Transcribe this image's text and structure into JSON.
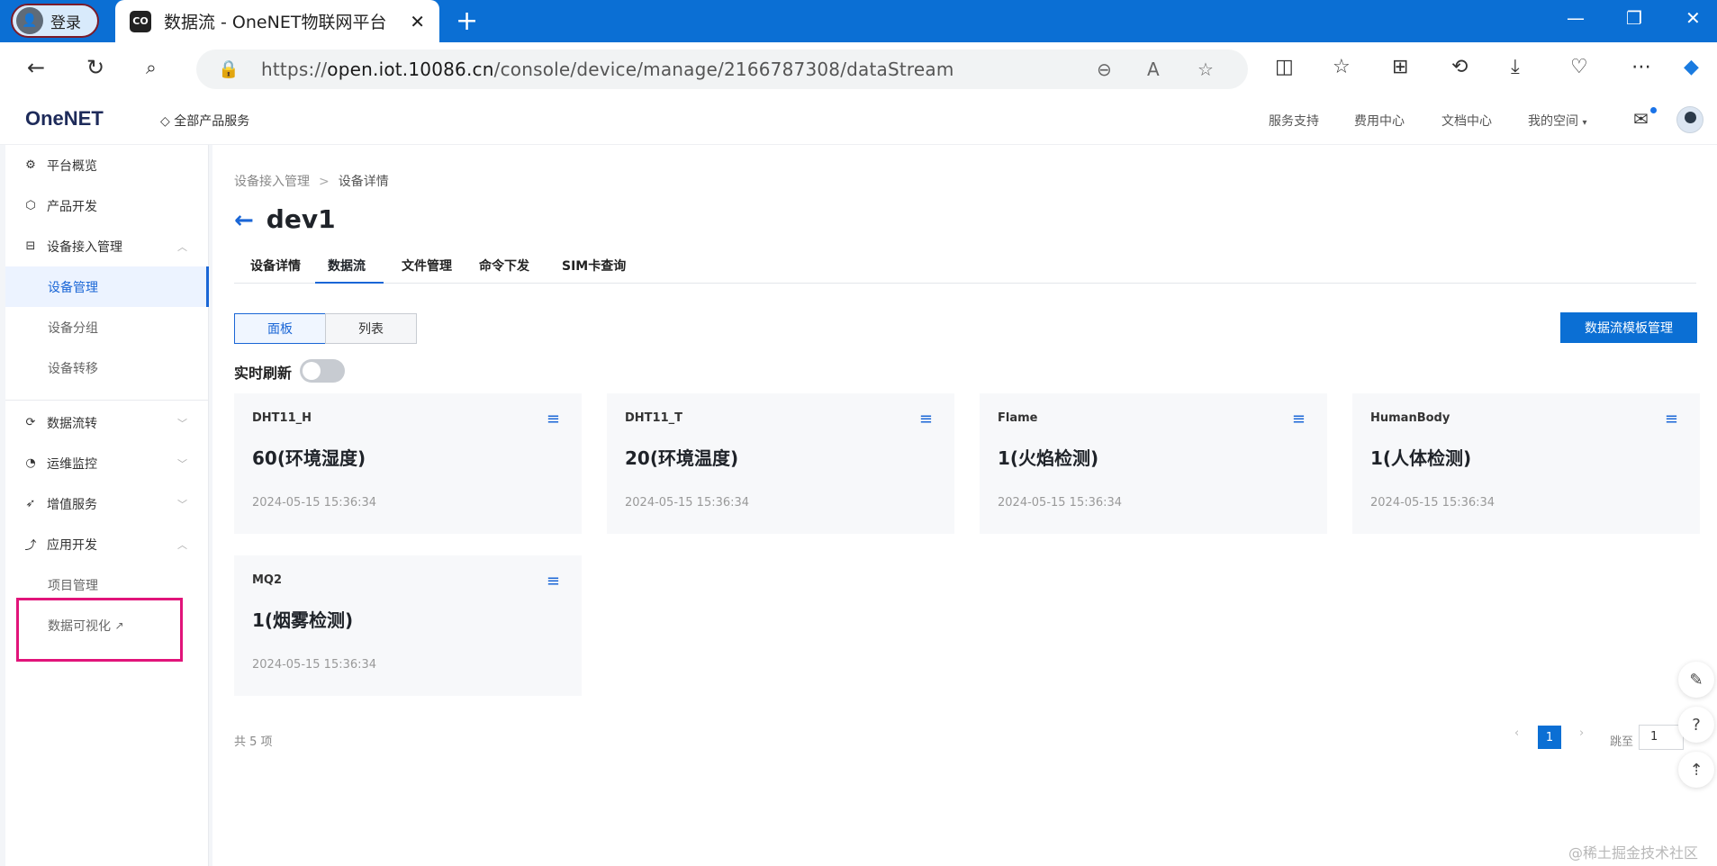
{
  "browser": {
    "profile_label": "登录",
    "tab_title": "数据流 - OneNET物联网平台",
    "url_prefix": "https://",
    "url_host": "open.iot.10086.cn",
    "url_path": "/console/device/manage/2166787308/dataStream"
  },
  "header": {
    "logo": "OneNET",
    "all_products": "全部产品服务",
    "links": [
      "服务支持",
      "费用中心",
      "文档中心",
      "我的空间"
    ]
  },
  "sidebar": {
    "items": [
      {
        "label": "平台概览"
      },
      {
        "label": "产品开发"
      },
      {
        "label": "设备接入管理"
      },
      {
        "label": "设备管理"
      },
      {
        "label": "设备分组"
      },
      {
        "label": "设备转移"
      },
      {
        "label": "数据流转"
      },
      {
        "label": "运维监控"
      },
      {
        "label": "增值服务"
      },
      {
        "label": "应用开发"
      },
      {
        "label": "项目管理"
      },
      {
        "label": "数据可视化"
      }
    ]
  },
  "main": {
    "breadcrumb": [
      "设备接入管理",
      "设备详情"
    ],
    "title": "dev1",
    "tabs": [
      "设备详情",
      "数据流",
      "文件管理",
      "命令下发",
      "SIM卡查询"
    ],
    "view_toggle": [
      "面板",
      "列表"
    ],
    "template_button": "数据流模板管理",
    "realtime_label": "实时刷新",
    "cards": [
      {
        "name": "DHT11_H",
        "value": "60(环境湿度)",
        "time": "2024-05-15 15:36:34"
      },
      {
        "name": "DHT11_T",
        "value": "20(环境温度)",
        "time": "2024-05-15 15:36:34"
      },
      {
        "name": "Flame",
        "value": "1(火焰检测)",
        "time": "2024-05-15 15:36:34"
      },
      {
        "name": "HumanBody",
        "value": "1(人体检测)",
        "time": "2024-05-15 15:36:34"
      },
      {
        "name": "MQ2",
        "value": "1(烟雾检测)",
        "time": "2024-05-15 15:36:34"
      }
    ],
    "total": "共 5 项",
    "current_page": "1",
    "jump_label": "跳至",
    "jump_value": "1"
  },
  "watermark": "@稀土掘金技术社区"
}
